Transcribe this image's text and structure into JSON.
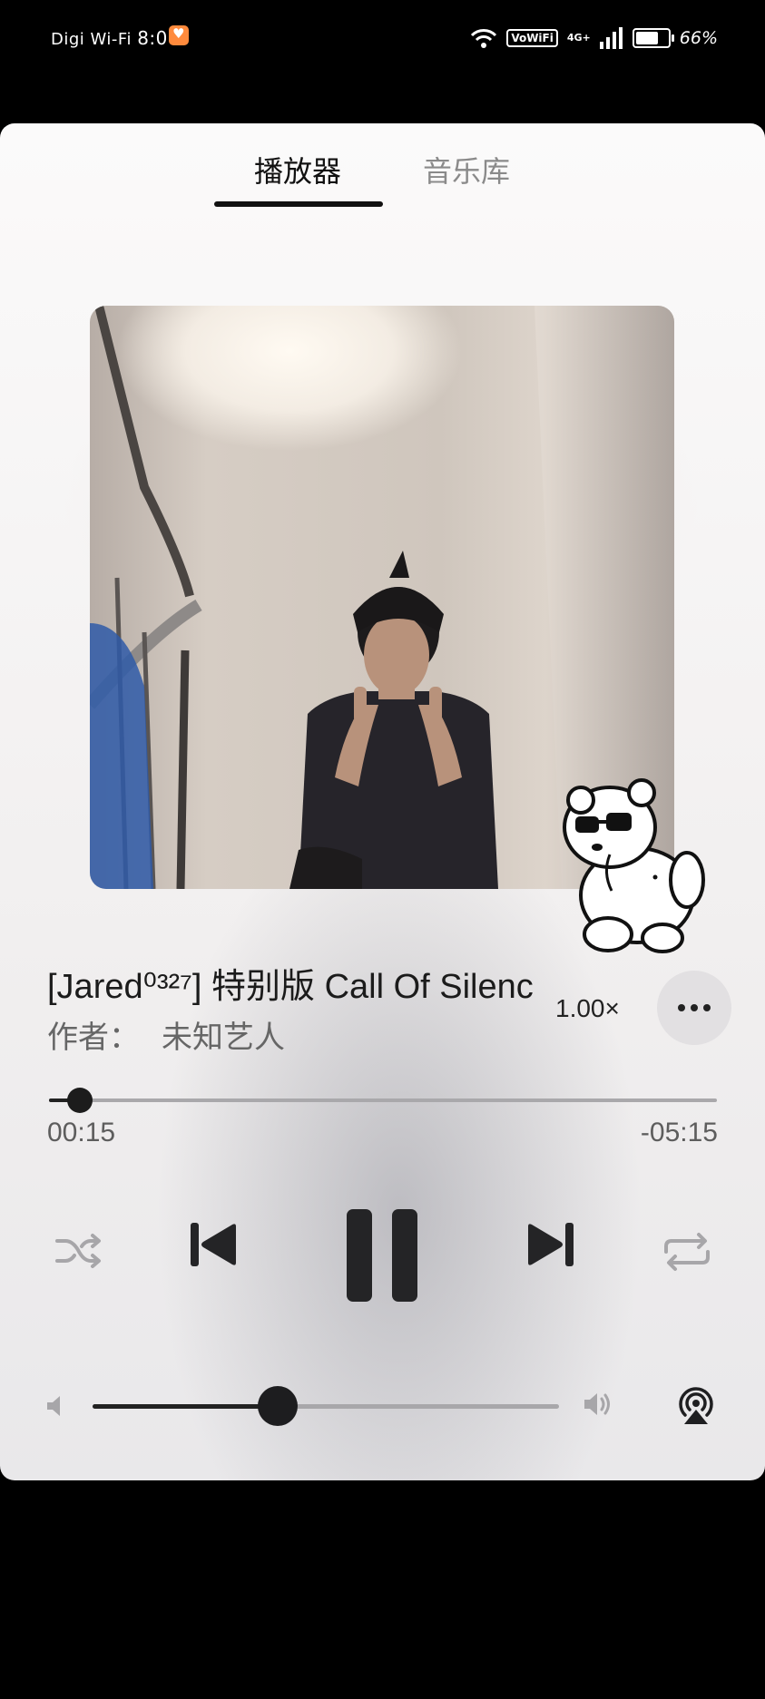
{
  "status_bar": {
    "carrier": "Digi Wi-Fi",
    "time": "8:07",
    "vowifi_label": "VoWiFi",
    "network_label": "4G+",
    "battery_percent": "66%",
    "icons": [
      "notification-app-icon",
      "wifi-icon",
      "signal-icon",
      "battery-icon"
    ]
  },
  "tabs": [
    {
      "label": "播放器",
      "active": true
    },
    {
      "label": "音乐库",
      "active": false
    }
  ],
  "track": {
    "title": "[Jared⁰³²⁷] 特别版 Call Of Silenc",
    "artist_label": "作者：",
    "artist_name": "未知艺人",
    "speed": "1.00×"
  },
  "progress": {
    "elapsed": "00:15",
    "remaining": "-05:15",
    "fraction": 0.046
  },
  "controls": {
    "icons": [
      "shuffle-icon",
      "previous-icon",
      "pause-icon",
      "next-icon",
      "repeat-icon"
    ]
  },
  "volume": {
    "level": 0.397,
    "icons": [
      "volume-low-icon",
      "volume-high-icon",
      "airplay-icon"
    ]
  },
  "colors": {
    "accent": "#1c1c1c",
    "muted_text": "#8a8a8a",
    "track_bg": "#a9a8ab"
  }
}
